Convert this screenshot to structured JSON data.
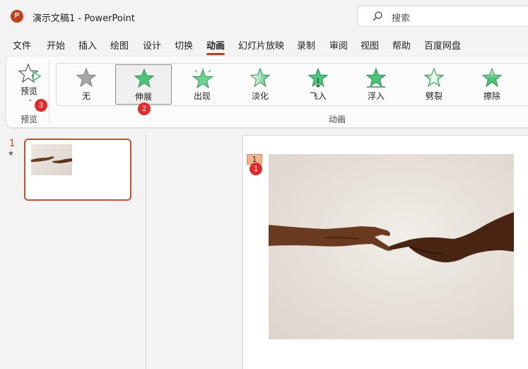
{
  "window": {
    "app_badge": "P",
    "title": "演示文稿1  -  PowerPoint",
    "search_placeholder": "搜索"
  },
  "tabs": [
    {
      "label": "文件"
    },
    {
      "label": "开始"
    },
    {
      "label": "插入"
    },
    {
      "label": "绘图"
    },
    {
      "label": "设计"
    },
    {
      "label": "切换"
    },
    {
      "label": "动画",
      "active": true
    },
    {
      "label": "幻灯片放映"
    },
    {
      "label": "录制"
    },
    {
      "label": "审阅"
    },
    {
      "label": "视图"
    },
    {
      "label": "帮助"
    },
    {
      "label": "百度网盘"
    }
  ],
  "ribbon": {
    "preview": {
      "label": "预览",
      "group_label": "预览"
    },
    "animations": {
      "group_label": "动画",
      "items": [
        {
          "label": "无",
          "icon": "star-gray-icon"
        },
        {
          "label": "伸展",
          "icon": "star-green-icon",
          "selected": true
        },
        {
          "label": "出现",
          "icon": "star-burst-icon"
        },
        {
          "label": "淡化",
          "icon": "star-fade-icon"
        },
        {
          "label": "飞入",
          "icon": "star-fly-icon"
        },
        {
          "label": "浮入",
          "icon": "star-float-icon"
        },
        {
          "label": "劈裂",
          "icon": "star-split-icon"
        },
        {
          "label": "擦除",
          "icon": "star-wipe-icon"
        }
      ]
    }
  },
  "badges": {
    "b1": "1",
    "b2": "2",
    "b3": "3"
  },
  "slides_pane": {
    "slide_number": "1",
    "star": "★"
  },
  "slide": {
    "animation_tag": "1"
  },
  "colors": {
    "accent": "#c43e1c",
    "star_green": "#3bb866",
    "badge_red": "#e12b2b"
  }
}
